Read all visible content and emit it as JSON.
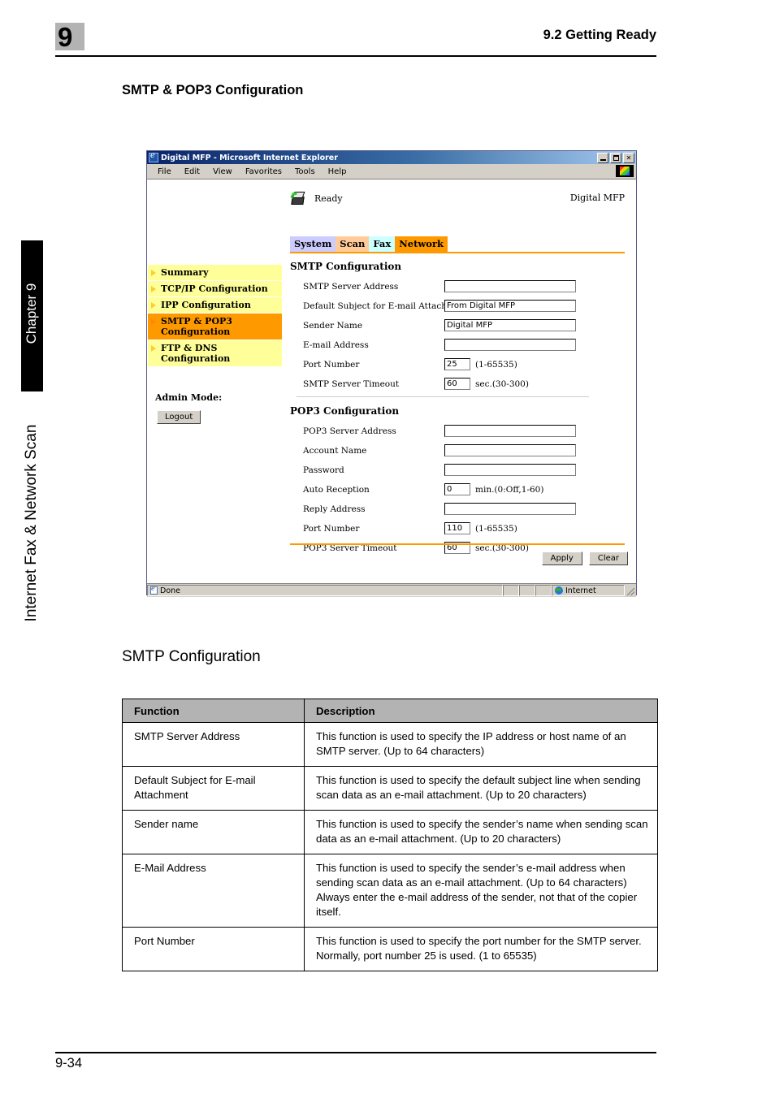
{
  "page": {
    "chapter_number": "9",
    "header_title": "9.2 Getting Ready",
    "section_heading": "SMTP & POP3 Configuration",
    "sub_heading": "SMTP Configuration",
    "footer_page_number": "9-34",
    "margin_chapter": "Chapter 9",
    "margin_subject": "Internet Fax & Network Scan"
  },
  "browser": {
    "title": "Digital MFP - Microsoft Internet Explorer",
    "window_controls": [
      "minimize",
      "maximize",
      "close"
    ],
    "menu": [
      "File",
      "Edit",
      "View",
      "Favorites",
      "Tools",
      "Help"
    ],
    "status_bar": {
      "message": "Done",
      "zone": "Internet"
    }
  },
  "webpage": {
    "device_status": "Ready",
    "device_model": "Digital MFP",
    "tabs": [
      {
        "label": "System",
        "color": "#ccccff"
      },
      {
        "label": "Scan",
        "color": "#ffcc99"
      },
      {
        "label": "Fax",
        "color": "#ccffff"
      },
      {
        "label": "Network",
        "color": "#ff9900"
      }
    ],
    "accent_color": "#ff9900",
    "sidebar": {
      "items": [
        {
          "label": "Summary",
          "active": false
        },
        {
          "label": "TCP/IP Configuration",
          "active": false
        },
        {
          "label": "IPP Configuration",
          "active": false
        },
        {
          "label": "SMTP & POP3 Configuration",
          "active": true
        },
        {
          "label": "FTP & DNS Configuration",
          "active": false
        }
      ],
      "admin_mode_label": "Admin Mode:",
      "logout_label": "Logout"
    },
    "smtp": {
      "title": "SMTP Configuration",
      "rows": [
        {
          "label": "SMTP Server Address",
          "value": "",
          "size": "wide",
          "suffix": ""
        },
        {
          "label": "Default Subject for E-mail Attachment",
          "value": "From Digital MFP",
          "size": "wide",
          "suffix": ""
        },
        {
          "label": "Sender Name",
          "value": "Digital MFP",
          "size": "wide",
          "suffix": ""
        },
        {
          "label": "E-mail Address",
          "value": "",
          "size": "wide",
          "suffix": ""
        },
        {
          "label": "Port Number",
          "value": "25",
          "size": "small",
          "suffix": "(1-65535)"
        },
        {
          "label": "SMTP Server Timeout",
          "value": "60",
          "size": "small",
          "suffix": "sec.(30-300)"
        }
      ]
    },
    "pop3": {
      "title": "POP3 Configuration",
      "rows": [
        {
          "label": "POP3 Server Address",
          "value": "",
          "size": "wide",
          "suffix": ""
        },
        {
          "label": "Account Name",
          "value": "",
          "size": "wide",
          "suffix": ""
        },
        {
          "label": "Password",
          "value": "",
          "size": "wide",
          "suffix": ""
        },
        {
          "label": "Auto Reception",
          "value": "0",
          "size": "small",
          "suffix": "min.(0:Off,1-60)"
        },
        {
          "label": "Reply Address",
          "value": "",
          "size": "wide",
          "suffix": ""
        },
        {
          "label": "Port Number",
          "value": "110",
          "size": "small",
          "suffix": "(1-65535)"
        },
        {
          "label": "POP3 Server Timeout",
          "value": "60",
          "size": "small",
          "suffix": "sec.(30-300)"
        }
      ]
    },
    "actions": {
      "apply_label": "Apply",
      "clear_label": "Clear"
    }
  },
  "table": {
    "headers": [
      "Function",
      "Description"
    ],
    "rows": [
      {
        "function": "SMTP Server Address",
        "description": "This function is used to specify the IP address or host name of an SMTP server. (Up to 64 characters)"
      },
      {
        "function": "Default Subject for E-mail Attachment",
        "description": "This function is used to specify the default subject line when sending scan data as an e-mail attachment. (Up to 20 characters)"
      },
      {
        "function": "Sender name",
        "description": "This function is used to specify the sender’s name when sending scan data as an e-mail attachment. (Up to 20 characters)"
      },
      {
        "function": "E-Mail Address",
        "description": "This function is used to specify the sender’s e-mail address when sending scan data as an e-mail attachment. (Up to 64 characters)\nAlways enter the e-mail address of the sender, not that of the copier itself."
      },
      {
        "function": "Port Number",
        "description": "This function is used to specify the port number for the SMTP server. Normally, port number 25 is used. (1 to 65535)"
      }
    ]
  }
}
